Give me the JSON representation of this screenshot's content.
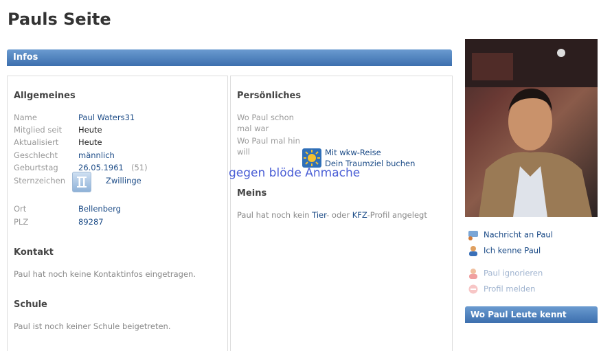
{
  "page": {
    "title": "Pauls Seite"
  },
  "infos": {
    "title": "Infos"
  },
  "allgemeines": {
    "heading": "Allgemeines",
    "rows": [
      {
        "label": "Name",
        "value": "Paul Waters31"
      },
      {
        "label": "Mitglied seit",
        "value": "Heute"
      },
      {
        "label": "Aktualisiert",
        "value": "Heute"
      },
      {
        "label": "Geschlecht",
        "value": "männlich"
      },
      {
        "label": "Geburtstag",
        "value": "26.05.1961",
        "extra": "(51)"
      },
      {
        "label": "Sternzeichen",
        "value": "Zwillinge"
      },
      {
        "label": "Ort",
        "value": "Bellenberg"
      },
      {
        "label": "PLZ",
        "value": "89287"
      }
    ]
  },
  "kontakt": {
    "heading": "Kontakt",
    "text": "Paul hat noch keine Kontaktinfos eingetragen."
  },
  "schule": {
    "heading": "Schule",
    "text": "Paul ist noch keiner Schule beigetreten."
  },
  "persoenliches": {
    "heading": "Persönliches",
    "wo_schon_label_1": "Wo Paul schon",
    "wo_schon_label_2": "mal war",
    "wo_hin_label_1": "Wo Paul mal hin",
    "wo_hin_label_2": "will",
    "travel_line1": "Mit wkw-Reise",
    "travel_line2": "Dein Traumziel buchen"
  },
  "overlay_text": "gegen blöde Anmache",
  "meins": {
    "heading": "Meins",
    "pre": "Paul hat noch kein ",
    "link1": "Tier",
    "mid": "- oder ",
    "link2": "KFZ",
    "post": "-Profil angelegt"
  },
  "sidebar": {
    "actions": [
      {
        "label": "Nachricht an Paul",
        "icon": "message-icon"
      },
      {
        "label": "Ich kenne Paul",
        "icon": "person-icon"
      },
      {
        "label": "Paul ignorieren",
        "icon": "person-ignore-icon"
      },
      {
        "label": "Profil melden",
        "icon": "report-icon"
      }
    ],
    "bar_title": "Wo Paul Leute kennt"
  },
  "colors": {
    "header_blue": "#3c6fae",
    "link": "#1a4a86",
    "overlay": "#4b5fd6"
  }
}
